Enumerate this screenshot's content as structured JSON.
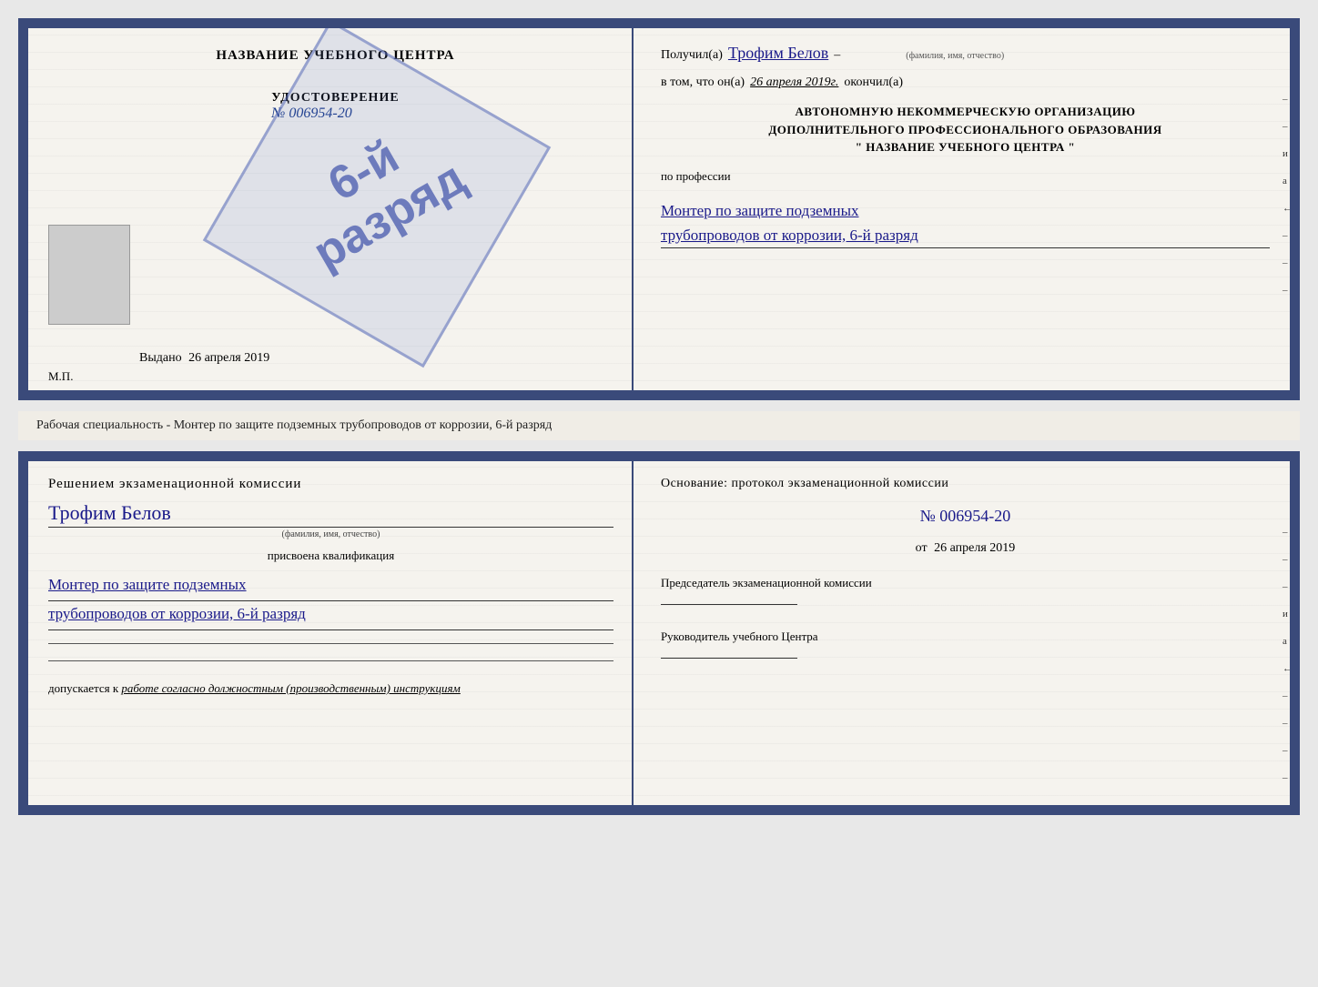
{
  "page": {
    "background": "#e8e8e8"
  },
  "cert_top": {
    "left": {
      "title": "НАЗВАНИЕ УЧЕБНОГО ЦЕНТРА",
      "stamp_text_line1": "6-й",
      "stamp_text_line2": "разряд",
      "udost_title": "УДОСТОВЕРЕНИЕ",
      "udost_num": "№ 006954-20",
      "vydano_label": "Выдано",
      "vydano_date": "26 апреля 2019",
      "mp": "М.П."
    },
    "right": {
      "poluchil_label": "Получил(а)",
      "poluchil_name": "Трофим Белов",
      "poluchil_subtext": "(фамилия, имя, отчество)",
      "dash1": "–",
      "vtom_label": "в том, что он(а)",
      "vtom_date": "26 апреля 2019г.",
      "okonchil": "окончил(а)",
      "org_line1": "АВТОНОМНУЮ НЕКОММЕРЧЕСКУЮ ОРГАНИЗАЦИЮ",
      "org_line2": "ДОПОЛНИТЕЛЬНОГО ПРОФЕССИОНАЛЬНОГО ОБРАЗОВАНИЯ",
      "org_line3": "\"   НАЗВАНИЕ УЧЕБНОГО ЦЕНТРА   \"",
      "po_professii": "по профессии",
      "profession_line1": "Монтер по защите подземных",
      "profession_line2": "трубопроводов от коррозии, 6-й разряд",
      "side_marks": [
        "–",
        "–",
        "и",
        "а",
        "←",
        "–",
        "–",
        "–"
      ]
    }
  },
  "middle": {
    "text": "Рабочая специальность - Монтер по защите подземных трубопроводов от коррозии, 6-й разряд"
  },
  "cert_bottom": {
    "left": {
      "heading": "Решением экзаменационной  комиссии",
      "name": "Трофим Белов",
      "name_subtext": "(фамилия, имя, отчество)",
      "prisvoena": "присвоена квалификация",
      "profession_line1": "Монтер по защите подземных",
      "profession_line2": "трубопроводов от коррозии, 6-й разряд",
      "dopuskaetsya_label": "допускается к",
      "dopuskaetsya_text": "работе согласно должностным (производственным) инструкциям"
    },
    "right": {
      "osnov_label": "Основание:  протокол  экзаменационной  комиссии",
      "prot_num": "№  006954-20",
      "ot_label": "от",
      "ot_date": "26 апреля 2019",
      "chairman_title": "Председатель экзаменационной комиссии",
      "ruk_title": "Руководитель учебного Центра",
      "side_marks": [
        "–",
        "–",
        "–",
        "и",
        "а",
        "←",
        "–",
        "–",
        "–",
        "–"
      ]
    }
  }
}
